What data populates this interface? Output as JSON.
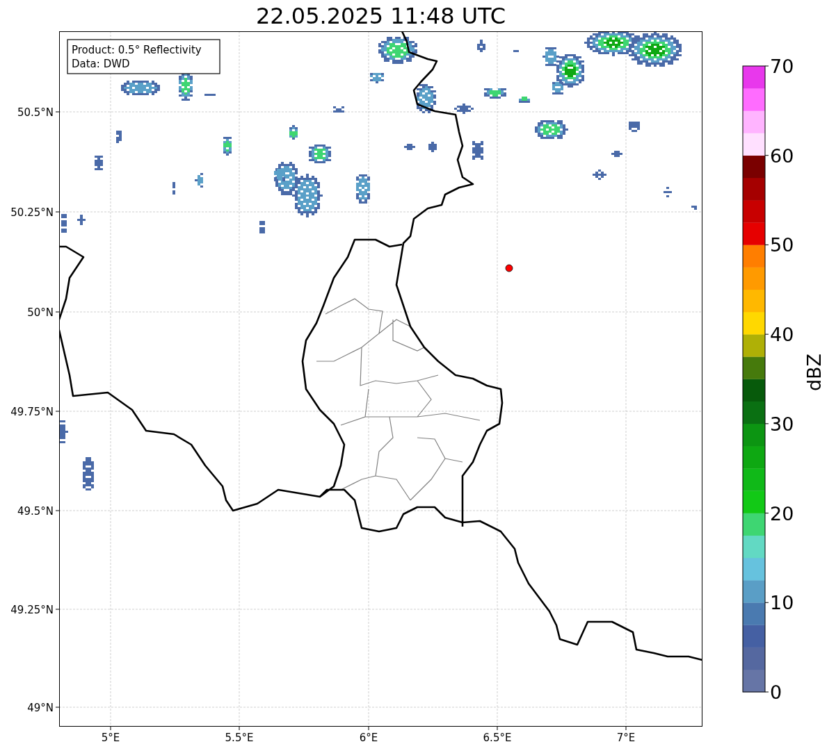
{
  "title": "22.05.2025 11:48 UTC",
  "map": {
    "annotation": [
      "Product: 0.5° Reflectivity",
      "Data: DWD"
    ],
    "lat_ticks": [
      "50.5°N",
      "50.25°N",
      "50°N",
      "49.75°N",
      "49.5°N",
      "49.25°N",
      "49°N"
    ],
    "lon_ticks": [
      "5°E",
      "5.5°E",
      "6°E",
      "6.5°E",
      "7°E"
    ]
  },
  "colorbar": {
    "label": "dBZ",
    "ticks": [
      "70",
      "60",
      "50",
      "40",
      "30",
      "20",
      "10",
      "0"
    ],
    "bins": [
      {
        "color": "#6675a6"
      },
      {
        "color": "#5568a0"
      },
      {
        "color": "#4560a3"
      },
      {
        "color": "#4a7ab0"
      },
      {
        "color": "#5a9ec6"
      },
      {
        "color": "#66c2de"
      },
      {
        "color": "#62d9c3"
      },
      {
        "color": "#3ed672"
      },
      {
        "color": "#12c916"
      },
      {
        "color": "#10b918"
      },
      {
        "color": "#0ea812"
      },
      {
        "color": "#0c9512"
      },
      {
        "color": "#0a7012"
      },
      {
        "color": "#075a0b"
      },
      {
        "color": "#467a0c"
      },
      {
        "color": "#afb006"
      },
      {
        "color": "#ffd800"
      },
      {
        "color": "#ffb800"
      },
      {
        "color": "#ff9a00"
      },
      {
        "color": "#ff7e00"
      },
      {
        "color": "#e60000"
      },
      {
        "color": "#c80000"
      },
      {
        "color": "#a50000"
      },
      {
        "color": "#7a0000"
      },
      {
        "color": "#ffe0ff"
      },
      {
        "color": "#ffb4ff"
      },
      {
        "color": "#ff6cff"
      },
      {
        "color": "#e838ec"
      }
    ]
  }
}
